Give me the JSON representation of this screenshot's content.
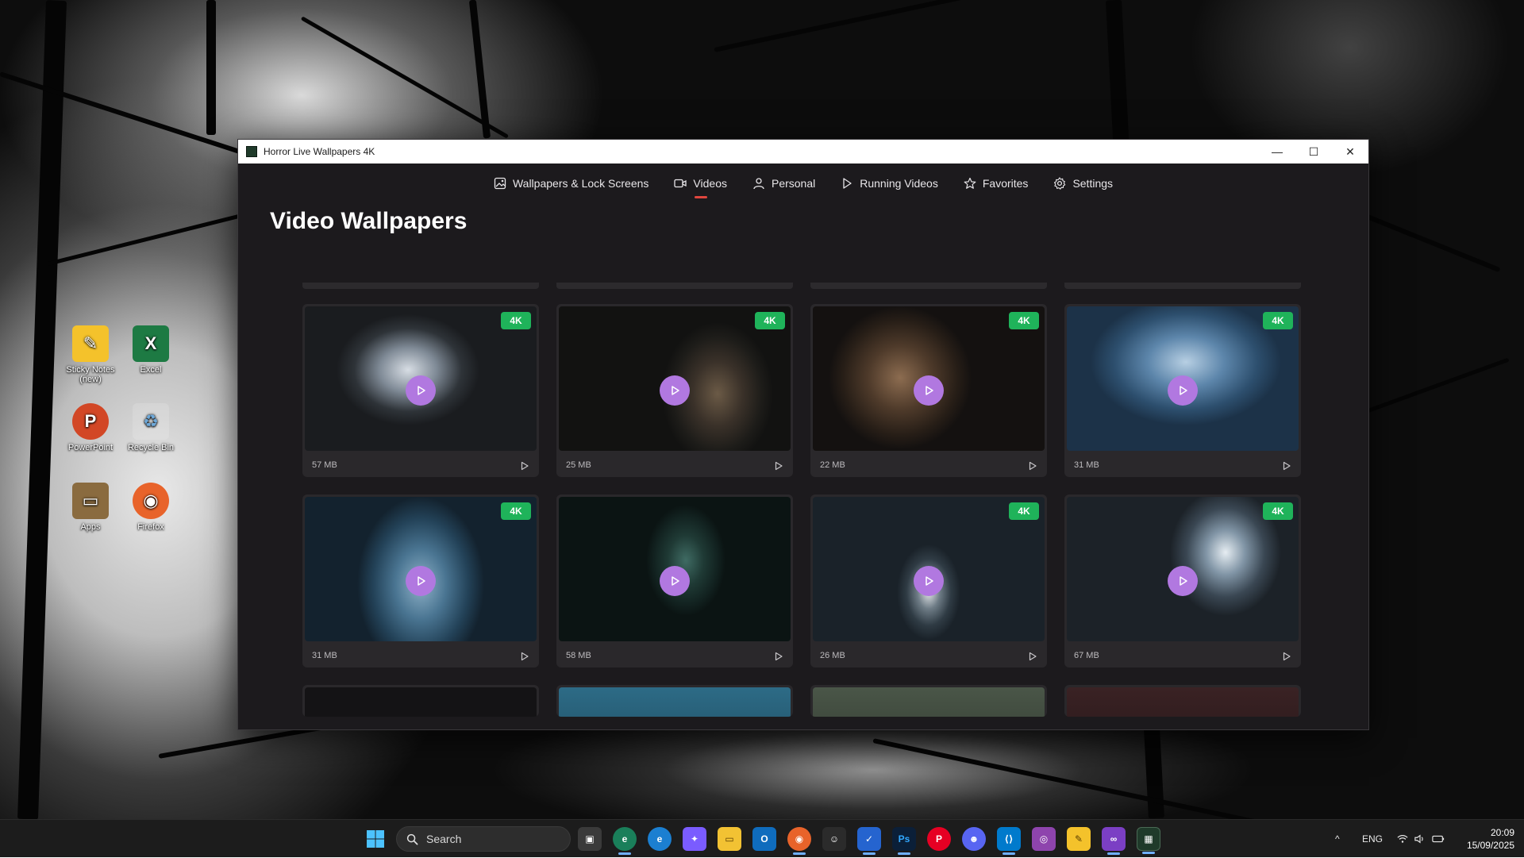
{
  "desktop": {
    "icons": [
      {
        "label": "Sticky Notes (new)",
        "color": "#f4c22b",
        "glyph": "✎"
      },
      {
        "label": "Excel",
        "color": "#1d7a43",
        "glyph": "X"
      },
      {
        "label": "PowerPoint",
        "color": "#d24726",
        "glyph": "P"
      },
      {
        "label": "Recycle Bin",
        "color": "#6ea8d8",
        "glyph": "♻"
      },
      {
        "label": "Apps",
        "color": "#8a6b3f",
        "glyph": "▭"
      },
      {
        "label": "Firefox",
        "color": "#e8632a",
        "glyph": "◉"
      }
    ]
  },
  "window": {
    "title": "Horror Live Wallpapers 4K",
    "controls": {
      "minimize": "—",
      "maximize": "☐",
      "close": "✕"
    }
  },
  "nav": {
    "items": [
      {
        "label": "Wallpapers & Lock Screens",
        "icon": "image-icon"
      },
      {
        "label": "Videos",
        "icon": "video-icon",
        "active": true
      },
      {
        "label": "Personal",
        "icon": "person-icon"
      },
      {
        "label": "Running Videos",
        "icon": "play-icon"
      },
      {
        "label": "Favorites",
        "icon": "star-icon"
      },
      {
        "label": "Settings",
        "icon": "gear-icon"
      }
    ],
    "active_indicator_color": "#e0463e"
  },
  "page": {
    "title": "Video Wallpapers"
  },
  "cards": [
    {
      "badge": "4K",
      "size": "57 MB",
      "scene": "ghost-smoke"
    },
    {
      "badge": "4K",
      "size": "25 MB",
      "scene": "doll-rocking-chair-dark"
    },
    {
      "badge": "4K",
      "size": "22 MB",
      "scene": "doll-rocking-chair-brown"
    },
    {
      "badge": "4K",
      "size": "31 MB",
      "scene": "doll-underwater"
    },
    {
      "badge": "4K",
      "size": "31 MB",
      "scene": "sheet-ghost-blue"
    },
    {
      "badge": "",
      "size": "58 MB",
      "scene": "dark-corridor"
    },
    {
      "badge": "4K",
      "size": "26 MB",
      "scene": "swing-ghost"
    },
    {
      "badge": "4K",
      "size": "67 MB",
      "scene": "abandoned-room"
    }
  ],
  "colors": {
    "badge": "#1fb35a",
    "play_button": "#b178e0",
    "window_bg": "#1c1a1d",
    "card_bg": "#2a282b"
  },
  "taskbar": {
    "search_placeholder": "Search",
    "apps": [
      {
        "name": "task-view",
        "color": "#3a3a3a",
        "glyph": "▣"
      },
      {
        "name": "edge-dev",
        "color": "#1a7f5a",
        "glyph": "e"
      },
      {
        "name": "edge",
        "color": "#1b7fd1",
        "glyph": "e"
      },
      {
        "name": "copilot",
        "color": "#7a5cff",
        "glyph": "✦"
      },
      {
        "name": "file-explorer",
        "color": "#f2c233",
        "glyph": "▭"
      },
      {
        "name": "outlook",
        "color": "#0f6cbd",
        "glyph": "O"
      },
      {
        "name": "firefox",
        "color": "#e8632a",
        "glyph": "◉"
      },
      {
        "name": "app-mask",
        "color": "#2b2b2b",
        "glyph": "☺"
      },
      {
        "name": "todo",
        "color": "#2564cf",
        "glyph": "✓"
      },
      {
        "name": "photoshop",
        "color": "#0b1f38",
        "glyph": "Ps"
      },
      {
        "name": "pinterest",
        "color": "#e60023",
        "glyph": "P"
      },
      {
        "name": "discord",
        "color": "#5865f2",
        "glyph": "☻"
      },
      {
        "name": "vscode",
        "color": "#007acc",
        "glyph": "⟨⟩"
      },
      {
        "name": "app-camera",
        "color": "#8e44ad",
        "glyph": "◎"
      },
      {
        "name": "sticky-notes",
        "color": "#f4c22b",
        "glyph": "✎"
      },
      {
        "name": "visual-studio",
        "color": "#7b3fc4",
        "glyph": "∞"
      },
      {
        "name": "horror-wallpapers",
        "color": "#1f3a2a",
        "glyph": "▦",
        "active": true
      }
    ],
    "tray": {
      "chevron": "^",
      "language": "ENG",
      "time": "20:09",
      "date": "15/09/2025"
    }
  }
}
